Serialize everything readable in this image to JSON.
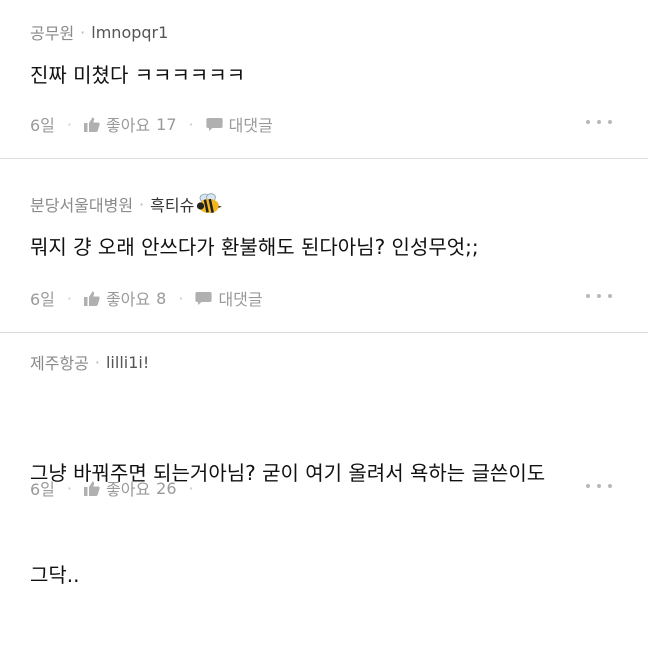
{
  "comments": [
    {
      "author": "공무원",
      "nickname": "lmnopqr1",
      "text": "진짜 미쳤다 ㅋㅋㅋㅋㅋㅋ",
      "time": "6일",
      "like_label": "좋아요",
      "like_count": "17",
      "reply_label": "대댓글",
      "more_icon": "more-dots-icon"
    },
    {
      "author": "분당서울대병원",
      "nickname": "흑티슈",
      "nickname_emoji": "bee-icon",
      "text": "뭐지 걍 오래 안쓰다가 환불해도 된다아님? 인성무엇;;",
      "time": "6일",
      "like_label": "좋아요",
      "like_count": "8",
      "reply_label": "대댓글",
      "more_icon": "more-dots-icon"
    },
    {
      "author": "제주항공",
      "nickname": "lilli1i!",
      "text_lines": [
        "그냥 바꿔주면 되는거아님? 굳이 여기 올려서 욕하는 글쓴이도",
        "그닥.."
      ],
      "time": "6일",
      "like_label": "좋아요",
      "like_count": "26",
      "more_icon": "more-dots-icon"
    }
  ],
  "colors": {
    "meta_text": "#8a8a8a",
    "action_text": "#9a9a9a",
    "divider": "#dcdcdc"
  }
}
